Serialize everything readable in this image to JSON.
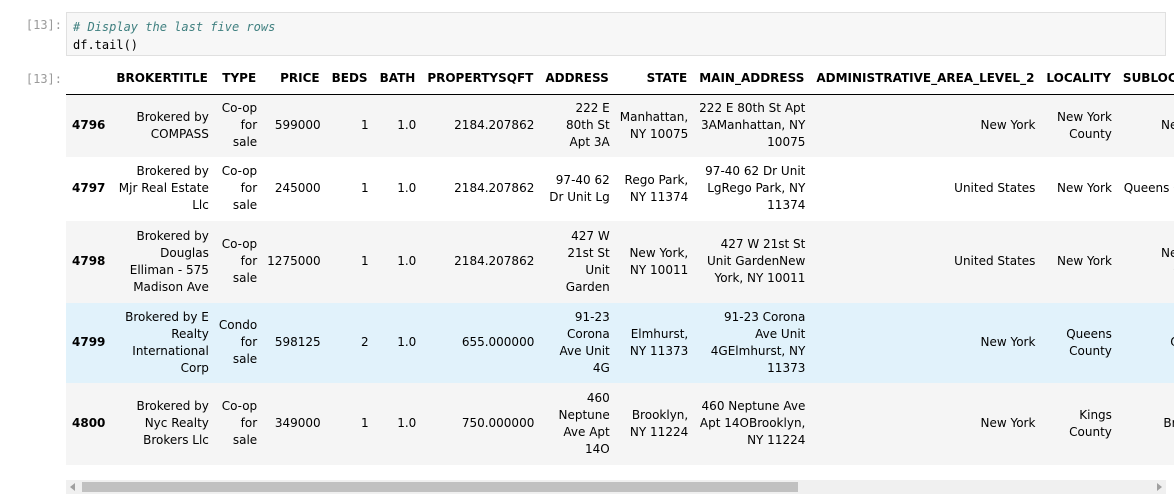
{
  "cell": {
    "in_prompt": "[13]:",
    "out_prompt": "[13]:",
    "code_comment": "# Display the last five rows",
    "code_line": "df.tail()"
  },
  "table": {
    "columns": [
      "BROKERTITLE",
      "TYPE",
      "PRICE",
      "BEDS",
      "BATH",
      "PROPERTYSQFT",
      "ADDRESS",
      "STATE",
      "MAIN_ADDRESS",
      "ADMINISTRATIVE_AREA_LEVEL_2",
      "LOCALITY",
      "SUBLOCALITY"
    ],
    "rows": [
      {
        "index": "4796",
        "cells": [
          "Brokered by COMPASS",
          "Co-op for sale",
          "599000",
          "1",
          "1.0",
          "2184.207862",
          "222 E 80th St Apt 3A",
          "Manhattan, NY 10075",
          "222 E 80th St Apt 3AManhattan, NY 10075",
          "New York",
          "New York County",
          "New York"
        ]
      },
      {
        "index": "4797",
        "cells": [
          "Brokered by Mjr Real Estate Llc",
          "Co-op for sale",
          "245000",
          "1",
          "1.0",
          "2184.207862",
          "97-40 62 Dr Unit Lg",
          "Rego Park, NY 11374",
          "97-40 62 Dr Unit LgRego Park, NY 11374",
          "United States",
          "New York",
          "Queens County"
        ]
      },
      {
        "index": "4798",
        "cells": [
          "Brokered by Douglas Elliman - 575 Madison Ave",
          "Co-op for sale",
          "1275000",
          "1",
          "1.0",
          "2184.207862",
          "427 W 21st St Unit Garden",
          "New York, NY 10011",
          "427 W 21st St Unit GardenNew York, NY 10011",
          "United States",
          "New York",
          "New York County"
        ]
      },
      {
        "index": "4799",
        "cells": [
          "Brokered by E Realty International Corp",
          "Condo for sale",
          "598125",
          "2",
          "1.0",
          "655.000000",
          "91-23 Corona Ave Unit 4G",
          "Elmhurst, NY 11373",
          "91-23 Corona Ave Unit 4GElmhurst, NY 11373",
          "New York",
          "Queens County",
          "Queens"
        ],
        "highlight": true
      },
      {
        "index": "4800",
        "cells": [
          "Brokered by Nyc Realty Brokers Llc",
          "Co-op for sale",
          "349000",
          "1",
          "1.0",
          "750.000000",
          "460 Neptune Ave Apt 14O",
          "Brooklyn, NY 11224",
          "460 Neptune Ave Apt 14OBrooklyn, NY 11224",
          "New York",
          "Kings County",
          "Brooklyn"
        ]
      }
    ]
  },
  "scrollbar": {
    "position_fraction": 0.0,
    "visible_fraction": 0.67
  }
}
